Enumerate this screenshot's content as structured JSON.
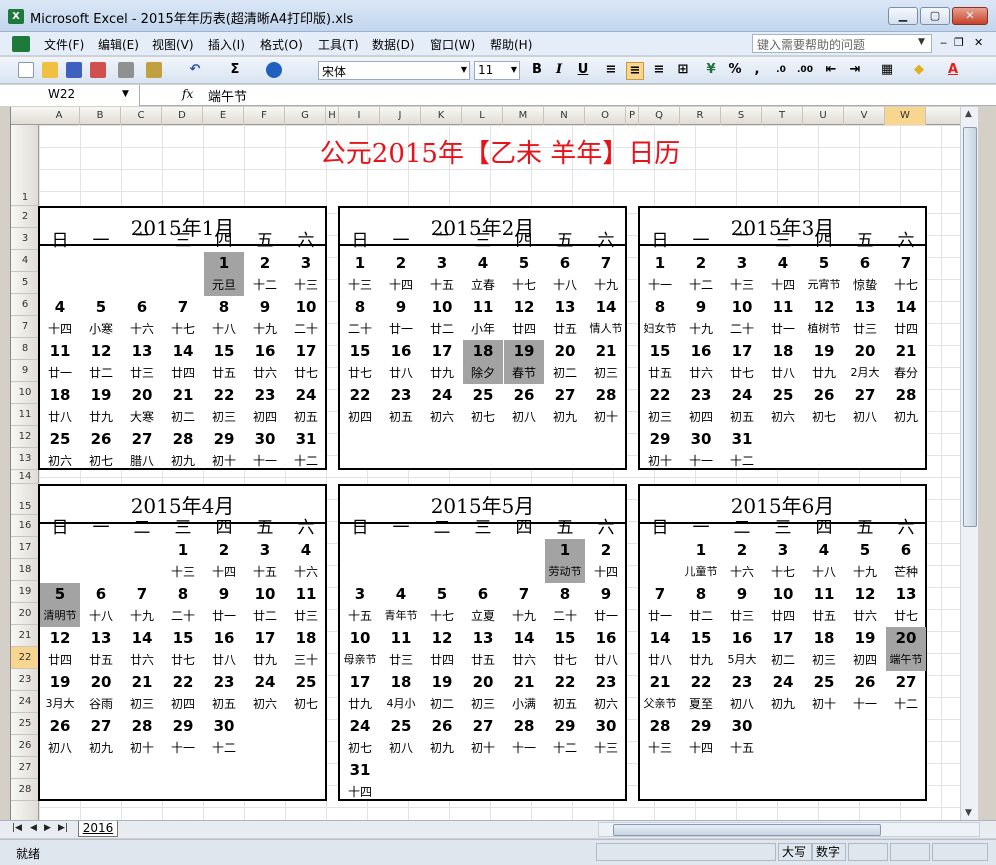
{
  "window": {
    "title": "Microsoft Excel - 2015年年历表(超清晰A4打印版).xls",
    "app_icon": "excel-icon"
  },
  "menu": {
    "items": [
      "文件(F)",
      "编辑(E)",
      "视图(V)",
      "插入(I)",
      "格式(O)",
      "工具(T)",
      "数据(D)",
      "窗口(W)",
      "帮助(H)"
    ],
    "help_placeholder": "键入需要帮助的问题"
  },
  "toolbar": {
    "font": "宋体",
    "size": "11",
    "bold": "B",
    "italic": "I",
    "underline": "U",
    "sum": "Σ",
    "percent": "%"
  },
  "formula": {
    "cell": "W22",
    "fx": "fx",
    "value": "端午节"
  },
  "columns": [
    "A",
    "B",
    "C",
    "D",
    "E",
    "F",
    "G",
    "H",
    "I",
    "J",
    "K",
    "L",
    "M",
    "N",
    "O",
    "P",
    "Q",
    "R",
    "S",
    "T",
    "U",
    "V",
    "W"
  ],
  "selected_column": "W",
  "rows": [
    "1",
    "2",
    "3",
    "4",
    "5",
    "6",
    "7",
    "8",
    "9",
    "10",
    "11",
    "12",
    "13",
    "14",
    "15",
    "16",
    "17",
    "18",
    "19",
    "20",
    "21",
    "22",
    "23",
    "24",
    "25",
    "26",
    "27",
    "28"
  ],
  "selected_row": "22",
  "calendar": {
    "title": "公元2015年【乙未 羊年】日历",
    "weekdays": [
      "日",
      "一",
      "二",
      "三",
      "四",
      "五",
      "六"
    ],
    "months": [
      {
        "title": "2015年1月",
        "start": 4,
        "days": 31,
        "lunar": [
          "元旦",
          "十二",
          "十三",
          "十四",
          "小寒",
          "十六",
          "十七",
          "十八",
          "十九",
          "二十",
          "廿一",
          "廿二",
          "廿三",
          "廿四",
          "廿五",
          "廿六",
          "廿七",
          "廿八",
          "廿九",
          "大寒",
          "初二",
          "初三",
          "初四",
          "初五",
          "初六",
          "初七",
          "腊八",
          "初九",
          "初十",
          "十一",
          "十二"
        ],
        "highlight": [
          1
        ]
      },
      {
        "title": "2015年2月",
        "start": 0,
        "days": 28,
        "lunar": [
          "十三",
          "十四",
          "十五",
          "立春",
          "十七",
          "十八",
          "十九",
          "二十",
          "廿一",
          "廿二",
          "小年",
          "廿四",
          "廿五",
          "情人节",
          "廿七",
          "廿八",
          "廿九",
          "除夕",
          "春节",
          "初二",
          "初三",
          "初四",
          "初五",
          "初六",
          "初七",
          "初八",
          "初九",
          "初十"
        ],
        "highlight": [
          18,
          19
        ]
      },
      {
        "title": "2015年3月",
        "start": 0,
        "days": 31,
        "lunar": [
          "十一",
          "十二",
          "十三",
          "十四",
          "元宵节",
          "惊蛰",
          "十七",
          "妇女节",
          "十九",
          "二十",
          "廿一",
          "植树节",
          "廿三",
          "廿四",
          "廿五",
          "廿六",
          "廿七",
          "廿八",
          "廿九",
          "2月大",
          "春分",
          "初三",
          "初四",
          "初五",
          "初六",
          "初七",
          "初八",
          "初九",
          "初十",
          "十一",
          "十二"
        ],
        "highlight": []
      },
      {
        "title": "2015年4月",
        "start": 3,
        "days": 30,
        "lunar": [
          "十三",
          "十四",
          "十五",
          "十六",
          "清明节",
          "十八",
          "十九",
          "二十",
          "廿一",
          "廿二",
          "廿三",
          "廿四",
          "廿五",
          "廿六",
          "廿七",
          "廿八",
          "廿九",
          "三十",
          "3月大",
          "谷雨",
          "初三",
          "初四",
          "初五",
          "初六",
          "初七",
          "初八",
          "初九",
          "初十",
          "十一",
          "十二"
        ],
        "highlight": [
          5
        ]
      },
      {
        "title": "2015年5月",
        "start": 5,
        "days": 31,
        "lunar": [
          "劳动节",
          "十四",
          "十五",
          "青年节",
          "十七",
          "立夏",
          "十九",
          "二十",
          "廿一",
          "母亲节",
          "廿三",
          "廿四",
          "廿五",
          "廿六",
          "廿七",
          "廿八",
          "廿九",
          "4月小",
          "初二",
          "初三",
          "小满",
          "初五",
          "初六",
          "初七",
          "初八",
          "初九",
          "初十",
          "十一",
          "十二",
          "十三",
          "十四"
        ],
        "highlight": [
          1
        ]
      },
      {
        "title": "2015年6月",
        "start": 1,
        "days": 30,
        "lunar": [
          "儿童节",
          "十六",
          "十七",
          "十八",
          "十九",
          "芒种",
          "廿一",
          "廿二",
          "廿三",
          "廿四",
          "廿五",
          "廿六",
          "廿七",
          "廿八",
          "廿九",
          "5月大",
          "初二",
          "初三",
          "初四",
          "端午节",
          "父亲节",
          "夏至",
          "初八",
          "初九",
          "初十",
          "十一",
          "十二",
          "十三",
          "十四",
          "十五"
        ],
        "highlight": [
          20
        ]
      }
    ]
  },
  "sheet_tab": "2016",
  "status": {
    "ready": "就绪",
    "caps": "大写",
    "num": "数字"
  }
}
